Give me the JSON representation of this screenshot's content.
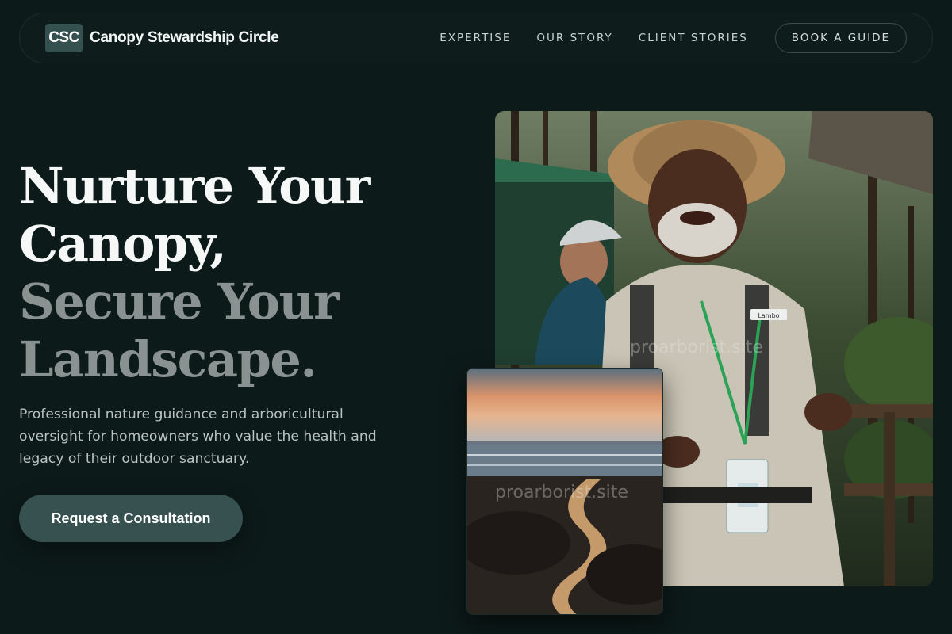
{
  "brand": {
    "logo_text": "CSC",
    "name": "Canopy Stewardship Circle"
  },
  "nav": {
    "links": [
      "EXPERTISE",
      "OUR STORY",
      "CLIENT STORIES"
    ],
    "cta_label": "BOOK A GUIDE"
  },
  "hero": {
    "headline_line1": "Nurture Your",
    "headline_line2": "Canopy,",
    "headline_line3": "Secure Your",
    "headline_line4": "Landscape.",
    "lede": "Professional nature guidance and arboricultural oversight for homeowners who value the health and legacy of their outdoor sanctuary.",
    "cta_label": "Request a Consultation"
  },
  "images": {
    "main_watermark": "proarborist.site",
    "inset_watermark": "proarborist.site",
    "badge_name": "Lambo"
  },
  "colors": {
    "background": "#0c1a19",
    "accent": "#36514f",
    "headline_dim": "#8a9291"
  }
}
